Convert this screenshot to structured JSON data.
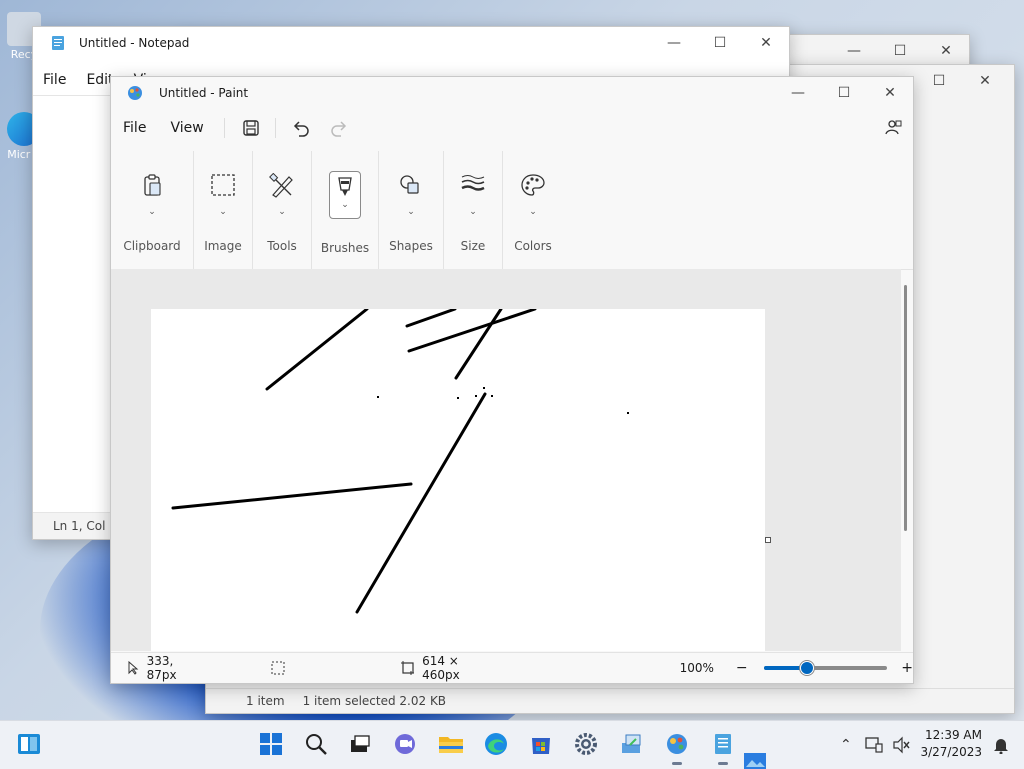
{
  "notepad": {
    "title": "Untitled - Notepad",
    "menu": [
      "File",
      "Edit",
      "View"
    ],
    "status": "Ln 1, Col 1"
  },
  "explorer": {
    "status_items": "1 item",
    "status_selected": "1 item selected  2.02 KB"
  },
  "desktop": {
    "icons": [
      "Recy",
      "Micr E"
    ]
  },
  "paint": {
    "title": "Untitled - Paint",
    "menu": {
      "file": "File",
      "view": "View"
    },
    "ribbon": [
      {
        "label": "Clipboard",
        "icon": "clipboard-icon"
      },
      {
        "label": "Image",
        "icon": "select-icon"
      },
      {
        "label": "Tools",
        "icon": "tools-icon"
      },
      {
        "label": "Brushes",
        "icon": "brush-icon"
      },
      {
        "label": "Shapes",
        "icon": "shapes-icon"
      },
      {
        "label": "Size",
        "icon": "size-icon"
      },
      {
        "label": "Colors",
        "icon": "palette-icon"
      }
    ],
    "status": {
      "cursor_pos": "333, 87px",
      "canvas_size": "614 × 460px",
      "zoom": "100%",
      "zoom_value": 0.33
    },
    "strokes_color": "#000000"
  },
  "taskbar": {
    "time": "12:39 AM",
    "date": "3/27/2023",
    "apps": [
      "start",
      "search",
      "task-view",
      "teams-chat",
      "file-explorer",
      "edge",
      "store",
      "settings",
      "control-panel",
      "paint",
      "notepad",
      "photos"
    ]
  },
  "colors": {
    "accent": "#0067c0"
  }
}
